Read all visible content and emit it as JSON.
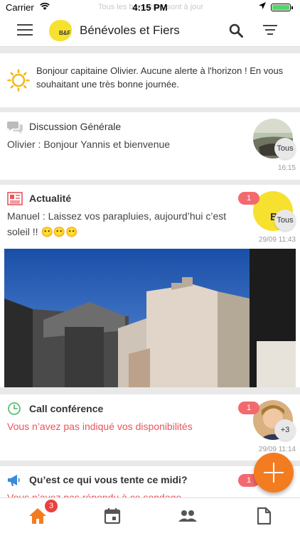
{
  "status_bar": {
    "carrier": "Carrier",
    "time": "4:15 PM",
    "ghost_text": "Tous les bénévoles sont à jour"
  },
  "app_bar": {
    "title": "Bénévoles et Fiers",
    "logo_text": "B&F"
  },
  "greeting": {
    "text": "Bonjour capitaine Olivier. Aucune alerte à l'horizon ! En vous souhaitant une très bonne journée."
  },
  "cards": [
    {
      "title": "Discussion Générale",
      "text": "Olivier : Bonjour Yannis et bienvenue",
      "time": "16:15",
      "audience": "Tous",
      "icon": "chat-icon"
    },
    {
      "title": "Actualité",
      "text": "Manuel : Laissez vos parapluies, aujourd’hui c’est soleil !! 😶😶😶",
      "time": "29/09 11:43",
      "audience": "Tous",
      "badge": "1",
      "icon": "newspaper-icon"
    },
    {
      "title": "Call conférence",
      "text": "Vous n’avez pas indiqué vos disponibilités",
      "time": "29/09 11:14",
      "audience": "+3",
      "badge": "1",
      "icon": "clock-icon"
    },
    {
      "title": "Qu’est ce qui vous tente ce midi?",
      "text": "Vous n’avez pas répondu à ce sondage",
      "badge": "1",
      "icon": "megaphone-icon"
    }
  ],
  "tab_bar": {
    "home_badge": "3"
  },
  "colors": {
    "accent": "#f47c20",
    "alert": "#e8555c",
    "badge": "#f26a6f",
    "logo": "#f7e12f"
  }
}
